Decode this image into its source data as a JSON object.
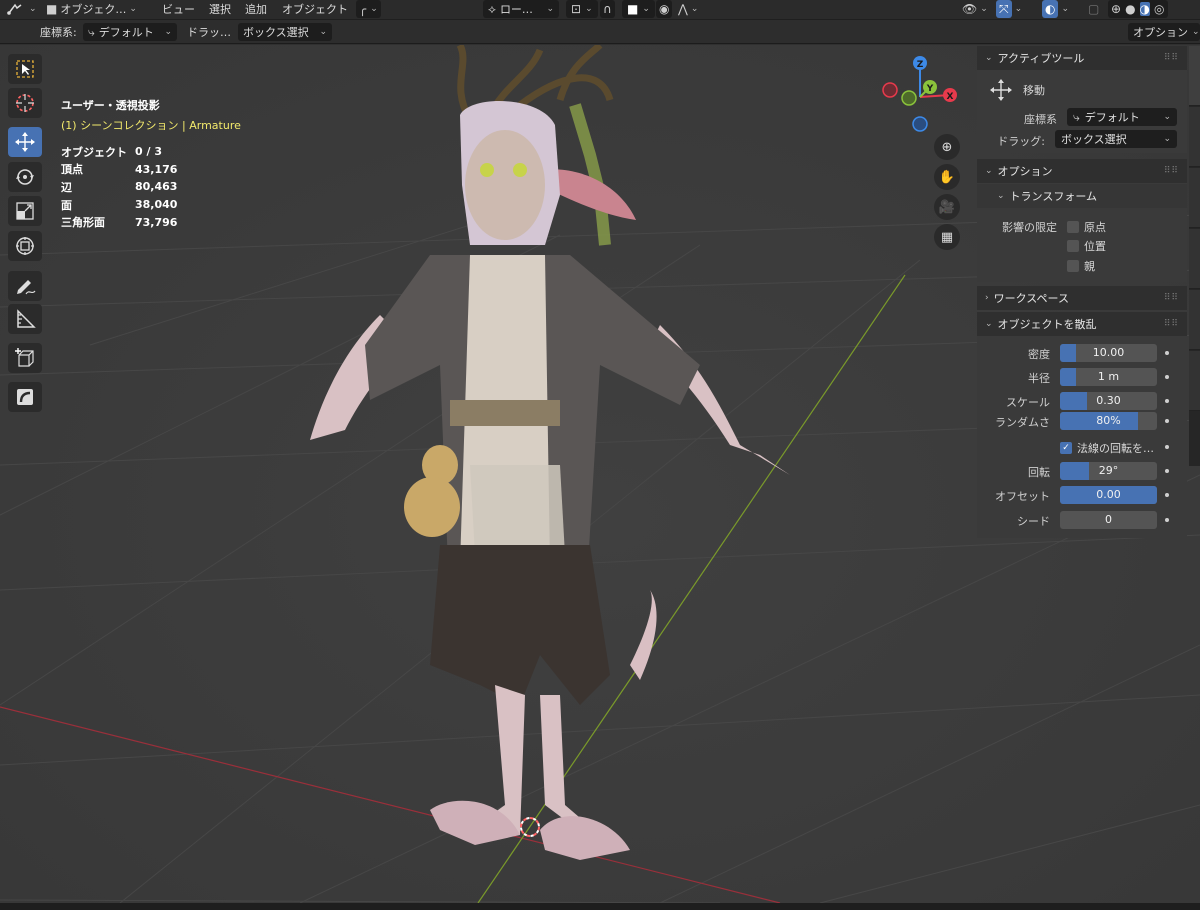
{
  "header": {
    "mode_label": "オブジェク…",
    "menus": [
      "ビュー",
      "選択",
      "追加",
      "オブジェクト"
    ],
    "pivot_label": "ロー…",
    "options_label": "オプション"
  },
  "toolsettings": {
    "coord_label": "座標系:",
    "coord_value": "デフォルト",
    "drag_label": "ドラッ…",
    "drag_value": "ボックス選択"
  },
  "viewport": {
    "view_title": "ユーザー・透視投影",
    "collection_prefix": "(1) シーンコレクション",
    "collection_sep": " | ",
    "active_object": "Armature",
    "stats": [
      {
        "label": "オブジェクト",
        "value": "0 / 3"
      },
      {
        "label": "頂点",
        "value": "43,176"
      },
      {
        "label": "辺",
        "value": "80,463"
      },
      {
        "label": "面",
        "value": "38,040"
      },
      {
        "label": "三角形面",
        "value": "73,796"
      }
    ],
    "gizmo_axes": {
      "x": "X",
      "y": "Y",
      "z": "Z"
    }
  },
  "sidebar": {
    "active_tool": {
      "header": "アクティブツール",
      "tool_name": "移動",
      "coord_label": "座標系",
      "coord_value": "デフォルト",
      "drag_label": "ドラッグ:",
      "drag_value": "ボックス選択"
    },
    "options": {
      "header": "オプション",
      "transform_header": "トランスフォーム",
      "affect_label": "影響の限定",
      "checks": [
        "原点",
        "位置",
        "親"
      ]
    },
    "workspace": {
      "header": "ワークスペース"
    },
    "scatter": {
      "header": "オブジェクトを散乱",
      "fields": [
        {
          "label": "密度",
          "value": "10.00",
          "fill": 0.17
        },
        {
          "label": "半径",
          "value": "1 m",
          "fill": 0.17
        },
        {
          "label": "スケール",
          "value": "0.30",
          "fill": 0.28
        },
        {
          "label": "ランダムさ",
          "value": "80%",
          "fill": 0.8
        }
      ],
      "normal_check_label": "法線の回転を…",
      "fields2": [
        {
          "label": "回転",
          "value": "29°",
          "fill": 0.3
        },
        {
          "label": "オフセット",
          "value": "0.00",
          "fill": 1.0
        },
        {
          "label": "シード",
          "value": "0",
          "fill": 0.0
        }
      ]
    }
  },
  "colors": {
    "accent": "#4772b3",
    "x_axis": "#e83a4c",
    "y_axis": "#8bc33b",
    "z_axis": "#3d8ae8",
    "collection": "#f2e96b"
  }
}
